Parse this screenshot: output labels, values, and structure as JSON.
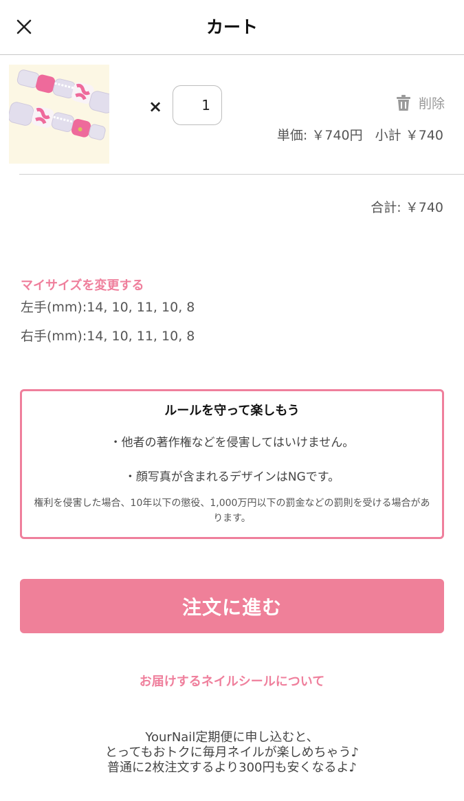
{
  "header": {
    "title": "カート",
    "close_icon": "close-icon"
  },
  "cart_item": {
    "image_icon": "nail-design-thumbnail",
    "multiply_sign": "×",
    "quantity": "1",
    "delete_label": "削除",
    "delete_icon": "trash-icon",
    "unit_price_label": "単価:",
    "unit_price_value": "￥740円",
    "subtotal_label": "小計",
    "subtotal_value": "￥740"
  },
  "total": {
    "label": "合計:",
    "value": "￥740"
  },
  "size": {
    "change_link": "マイサイズを変更する",
    "left_hand": "左手(mm):14, 10, 11, 10, 8",
    "right_hand": "右手(mm):14, 10, 11, 10, 8"
  },
  "rules": {
    "title": "ルールを守って楽しもう",
    "items": [
      "・他者の著作権などを侵害してはいけません。",
      "・顔写真が含まれるデザインはNGです。"
    ],
    "note": "権利を侵害した場合、10年以下の懲役、1,000万円以下の罰金などの罰則を受ける場合があります。"
  },
  "order_button": "注文に進む",
  "seal_link": "お届けするネイルシールについて",
  "promo": [
    "YourNail定期便に申し込むと、",
    "とってもおトクに毎月ネイルが楽しめちゃう♪",
    "普通に2枚注文するより300円も安くなるよ♪"
  ],
  "colors": {
    "accent": "#ef7f9c",
    "button": "#ef8099",
    "thumb_bg": "#fcf7e4"
  }
}
